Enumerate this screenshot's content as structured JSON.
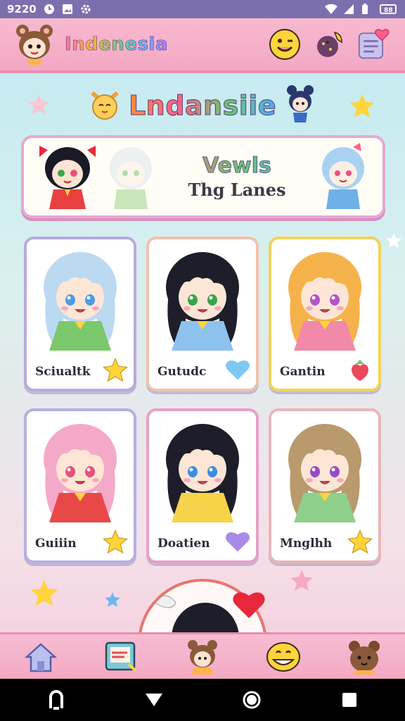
{
  "status_bar": {
    "time": "9220",
    "icons": [
      "clock-icon",
      "image-icon",
      "settings-icon",
      "wifi-icon",
      "signal-icon",
      "battery-icon",
      "battery-saver-icon"
    ]
  },
  "header": {
    "title": "Indenesia",
    "avatar_icon": "bear-girl-avatar-icon",
    "actions": [
      "smiley-icon",
      "cookie-icon",
      "notes-heart-icon"
    ]
  },
  "section": {
    "title": "Lndansiie"
  },
  "banner": {
    "line1": "Vewls",
    "line2": "Thg Lanes",
    "characters": [
      "red-bow-girl-icon",
      "white-hair-girl-icon",
      "blue-hair-girl-icon"
    ]
  },
  "cards": [
    {
      "name": "Sciualtk",
      "hair": "#bcd9f2",
      "outfit": "#7cc86c",
      "eyes": "#4b9be8",
      "badge": "star-icon",
      "badge_color": "#ffd43b",
      "border": "#b9a9dd"
    },
    {
      "name": "Gutudc",
      "hair": "#1e1e2a",
      "outfit": "#8ec2ee",
      "eyes": "#3aa64a",
      "badge": "heart-icon",
      "badge_color": "#7fc8f2",
      "border": "#f0c2b0"
    },
    {
      "name": "Gantin",
      "hair": "#f6b24a",
      "outfit": "#f08aa8",
      "eyes": "#b054c8",
      "badge": "strawberry-icon",
      "badge_color": "#e84a5a",
      "border": "#f3d25a"
    },
    {
      "name": "Guiiin",
      "hair": "#f5a9c9",
      "outfit": "#e84848",
      "eyes": "#e8507a",
      "badge": "star-icon",
      "badge_color": "#ffd43b",
      "border": "#b3b0e3"
    },
    {
      "name": "Doatien",
      "hair": "#1e1e2a",
      "outfit": "#f6d34a",
      "eyes": "#3a8ee0",
      "badge": "heart-icon",
      "badge_color": "#a88ae8",
      "border": "#e8a0c8"
    },
    {
      "name": "Mnglhh",
      "hair": "#b99a6c",
      "outfit": "#8ed08a",
      "eyes": "#9a4ac0",
      "badge": "star-icon",
      "badge_color": "#ffd43b",
      "border": "#e8b6ba"
    }
  ],
  "bottom_nav": [
    "home-icon",
    "picture-frame-icon",
    "bear-girl-icon",
    "grin-icon",
    "bear-icon"
  ],
  "system_nav": [
    "recent-apps-icon",
    "back-icon",
    "home-circle-icon",
    "overview-icon"
  ]
}
